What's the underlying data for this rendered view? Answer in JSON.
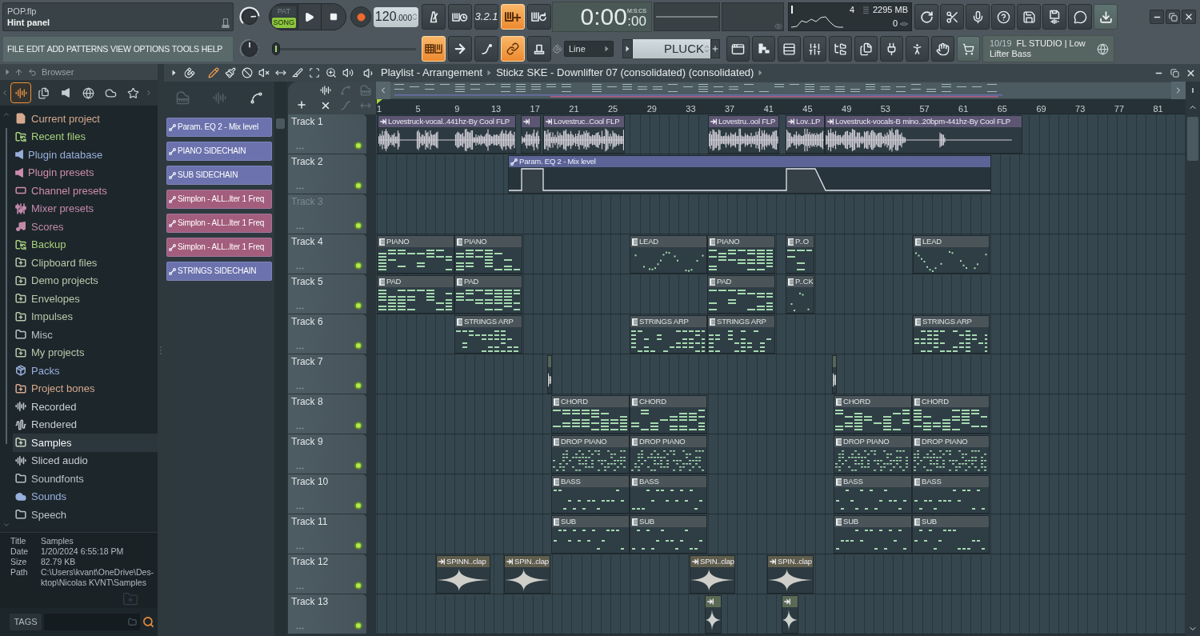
{
  "hint_panel": {
    "file": "POP.flp",
    "hint": "Hint panel"
  },
  "menu": [
    "FILE",
    "EDIT",
    "ADD",
    "PATTERNS",
    "VIEW",
    "OPTIONS",
    "TOOLS",
    "HELP"
  ],
  "knobs": [
    {
      "level": 0.82
    },
    {
      "level": 0.5
    }
  ],
  "transport": {
    "modes": [
      {
        "label": "PAT",
        "selected": false
      },
      {
        "label": "SONG",
        "selected": true
      }
    ],
    "tempo": "120",
    "tempo_fraction": ".000"
  },
  "record_options": [
    {
      "kind": "metronome",
      "on": false
    },
    {
      "kind": "wait",
      "on": false
    },
    {
      "kind": "countdown",
      "label": "3.2.1",
      "on": false
    },
    {
      "kind": "step-edit",
      "on": true
    },
    {
      "kind": "loop-record",
      "on": false
    }
  ],
  "time": {
    "value": "0:00",
    "fraction": ":00",
    "format": "M:S:CS"
  },
  "cpu": {
    "reading_1": "4",
    "memory": "2295 MB",
    "reading_2": "0"
  },
  "position_slider": {
    "level": 0
  },
  "edit_options": [
    {
      "kind": "step-grid",
      "on": true
    },
    {
      "kind": "arrow",
      "on": false
    },
    {
      "kind": "curve",
      "on": false
    },
    {
      "kind": "link",
      "on": true
    },
    {
      "kind": "knob",
      "on": false
    }
  ],
  "snap": "Line",
  "pattern": "PLUCK",
  "news": {
    "count": "10/19",
    "text": "FL STUDIO | Low Lifter Bass"
  },
  "browser": {
    "title": "Browser",
    "tabs": [
      {
        "kind": "all",
        "selected": true
      },
      {
        "kind": "files",
        "selected": false
      },
      {
        "kind": "plugins",
        "selected": false
      },
      {
        "kind": "web",
        "selected": false
      },
      {
        "kind": "cloud",
        "selected": false
      },
      {
        "kind": "favorites",
        "selected": false
      }
    ],
    "items": [
      {
        "label": "Current project",
        "kind": "project",
        "color": "#d6a98e",
        "selected": false
      },
      {
        "label": "Recent files",
        "kind": "recent",
        "color": "#a6cf7c",
        "selected": false
      },
      {
        "label": "Plugin database",
        "kind": "plugin",
        "color": "#98afdb",
        "selected": false
      },
      {
        "label": "Plugin presets",
        "kind": "plugin",
        "color": "#cf8cae",
        "selected": false
      },
      {
        "label": "Channel presets",
        "kind": "channel",
        "color": "#cf8cae",
        "selected": false
      },
      {
        "label": "Mixer presets",
        "kind": "mixer",
        "color": "#c48aac",
        "selected": false
      },
      {
        "label": "Scores",
        "kind": "score",
        "color": "#c08aa8",
        "selected": false
      },
      {
        "label": "Backup",
        "kind": "recent",
        "color": "#a6cf7c",
        "selected": false
      },
      {
        "label": "Clipboard files",
        "kind": "folder-plus",
        "color": "#b7c8aa",
        "selected": false
      },
      {
        "label": "Demo projects",
        "kind": "folder-plus",
        "color": "#b7c8aa",
        "selected": false
      },
      {
        "label": "Envelopes",
        "kind": "folder-plus",
        "color": "#b7c8aa",
        "selected": false
      },
      {
        "label": "Impulses",
        "kind": "folder-plus",
        "color": "#b7c8aa",
        "selected": false
      },
      {
        "label": "Misc",
        "kind": "folder",
        "color": "#b5c2c7",
        "selected": false
      },
      {
        "label": "My projects",
        "kind": "folder-plus",
        "color": "#b7c8aa",
        "selected": false
      },
      {
        "label": "Packs",
        "kind": "packs",
        "color": "#98afdb",
        "selected": false
      },
      {
        "label": "Project bones",
        "kind": "folder-plus",
        "color": "#d6a98e",
        "selected": false
      },
      {
        "label": "Recorded",
        "kind": "wave",
        "color": "#c6ced2",
        "selected": false
      },
      {
        "label": "Rendered",
        "kind": "rendered",
        "color": "#c6ced2",
        "selected": false
      },
      {
        "label": "Samples",
        "kind": "folder-plus",
        "color": "#c9d6bf",
        "selected": true
      },
      {
        "label": "Sliced audio",
        "kind": "wave",
        "color": "#c6ced2",
        "selected": false
      },
      {
        "label": "Soundfonts",
        "kind": "folder",
        "color": "#b5c2c7",
        "selected": false
      },
      {
        "label": "Sounds",
        "kind": "cloud",
        "color": "#98afdb",
        "selected": false
      },
      {
        "label": "Speech",
        "kind": "folder",
        "color": "#b5c2c7",
        "selected": false
      }
    ],
    "info": [
      {
        "label": "Title",
        "value": "Samples"
      },
      {
        "label": "Date",
        "value": "1/20/2024 6:55:18 PM"
      },
      {
        "label": "Size",
        "value": "82.79 KB"
      },
      {
        "label": "Path",
        "value": "C:\\Users\\kvant\\OneDrive\\Des-ktop\\Nicolas KVNT\\Samples"
      }
    ],
    "tags": "TAGS"
  },
  "playlist": {
    "title": "Playlist - Arrangement",
    "selection": "Stickz SKE - Downlifter 07 (consolidated) (consolidated)",
    "tools": [
      {
        "kind": "draw",
        "selected": true
      },
      {
        "kind": "paint",
        "selected": false
      },
      {
        "kind": "delete",
        "selected": false
      },
      {
        "kind": "mute",
        "selected": false
      },
      {
        "kind": "slip",
        "selected": false
      },
      {
        "kind": "slice",
        "selected": false
      },
      {
        "kind": "select",
        "selected": false
      },
      {
        "kind": "zoom",
        "selected": false
      },
      {
        "kind": "playback",
        "selected": false
      }
    ],
    "picker_tabs": [
      {
        "kind": "pattern",
        "selected": false
      },
      {
        "kind": "audio",
        "selected": false
      },
      {
        "kind": "automation",
        "selected": true
      }
    ],
    "picker_items": [
      {
        "label": "Param. EQ 2 - Mix level",
        "color": "#6b72ad"
      },
      {
        "label": "PIANO SIDECHAIN",
        "color": "#6b72ad"
      },
      {
        "label": "SUB SIDECHAIN",
        "color": "#6b72ad"
      },
      {
        "label": "Simplon - ALL..lter 1 Freq",
        "color": "#a35d7d"
      },
      {
        "label": "Simplon - ALL..lter 1 Freq",
        "color": "#a35d7d"
      },
      {
        "label": "Simplon - ALL..lter 1 Freq",
        "color": "#a35d7d"
      },
      {
        "label": "STRINGS SIDECHAIN",
        "color": "#6b72ad"
      }
    ],
    "track_filters": [
      {
        "kind": "audio",
        "on": true
      },
      {
        "kind": "automation",
        "on": false
      },
      {
        "kind": "pattern",
        "on": false
      },
      {
        "kind": "clear",
        "on": true
      },
      {
        "kind": "curve",
        "on": false
      },
      {
        "kind": "stretch",
        "on": false
      }
    ],
    "ruler": [
      "1",
      "5",
      "9",
      "13",
      "17",
      "21",
      "25",
      "29",
      "33",
      "37",
      "41",
      "45",
      "49",
      "53",
      "57",
      "61",
      "65",
      "69",
      "73",
      "77",
      "81"
    ],
    "tracks": [
      {
        "name": "Track 1",
        "dimmed": false,
        "enabled": true,
        "clips": [
          {
            "kind": "audio",
            "label": "Lovestruck-vocal..441hz-By Cool FLP",
            "color": "#5c5673"
          },
          {
            "kind": "audio",
            "color": "#5c5673"
          },
          {
            "kind": "audio",
            "label": "Lovestruc..Cool FLP",
            "color": "#5c5673"
          },
          {
            "kind": "audio",
            "label": "Lovestru..ool FLP",
            "color": "#5c5673"
          },
          {
            "kind": "audio",
            "label": "Lov..LP",
            "color": "#5c5673"
          },
          {
            "kind": "audio",
            "label": "Lovestruck-vocals-B mino..20bpm-441hz-By Cool FLP",
            "color": "#5c5673"
          }
        ]
      },
      {
        "name": "Track 2",
        "dimmed": false,
        "enabled": true,
        "clips": [
          {
            "kind": "automation",
            "label": "Param. EQ 2 - Mix level",
            "color": "#5c6497"
          }
        ]
      },
      {
        "name": "Track 3",
        "dimmed": true,
        "enabled": true
      },
      {
        "name": "Track 4",
        "dimmed": false,
        "enabled": true,
        "clips": [
          {
            "kind": "pattern",
            "label": "PIANO",
            "color": "#4b5458"
          },
          {
            "kind": "pattern",
            "label": "PIANO",
            "color": "#4b5458"
          },
          {
            "kind": "pattern",
            "label": "LEAD",
            "color": "#4b5458"
          },
          {
            "kind": "pattern",
            "label": "PIANO",
            "color": "#4b5458"
          },
          {
            "kind": "pattern",
            "label": "P..O",
            "color": "#4b5458"
          },
          {
            "kind": "pattern",
            "label": "LEAD",
            "color": "#4b5458"
          }
        ]
      },
      {
        "name": "Track 5",
        "dimmed": false,
        "enabled": true,
        "clips": [
          {
            "kind": "pattern",
            "label": "PAD",
            "color": "#4b5458"
          },
          {
            "kind": "pattern",
            "label": "PAD",
            "color": "#4b5458"
          },
          {
            "kind": "pattern",
            "label": "PAD",
            "color": "#4b5458"
          },
          {
            "kind": "pattern",
            "label": "P..CK",
            "color": "#4b5458"
          }
        ]
      },
      {
        "name": "Track 6",
        "dimmed": false,
        "enabled": true,
        "clips": [
          {
            "kind": "pattern",
            "label": "STRINGS ARP",
            "color": "#4b5458"
          },
          {
            "kind": "pattern",
            "label": "STRINGS ARP",
            "color": "#4b5458"
          },
          {
            "kind": "pattern",
            "label": "STRINGS ARP",
            "color": "#4b5458"
          },
          {
            "kind": "pattern",
            "label": "STRINGS ARP",
            "color": "#4b5458"
          }
        ]
      },
      {
        "name": "Track 7",
        "dimmed": false,
        "enabled": true,
        "clips": [
          {
            "kind": "audio",
            "color": "#56645a"
          },
          {
            "kind": "audio",
            "color": "#56645a"
          }
        ]
      },
      {
        "name": "Track 8",
        "dimmed": false,
        "enabled": true,
        "clips": [
          {
            "kind": "pattern",
            "label": "CHORD",
            "color": "#4b5458"
          },
          {
            "kind": "pattern",
            "label": "CHORD",
            "color": "#4b5458"
          },
          {
            "kind": "pattern",
            "label": "CHORD",
            "color": "#4b5458"
          },
          {
            "kind": "pattern",
            "label": "CHORD",
            "color": "#4b5458"
          }
        ]
      },
      {
        "name": "Track 9",
        "dimmed": false,
        "enabled": true,
        "clips": [
          {
            "kind": "pattern",
            "label": "DROP PIANO",
            "color": "#4b5458"
          },
          {
            "kind": "pattern",
            "label": "DROP PIANO",
            "color": "#4b5458"
          },
          {
            "kind": "pattern",
            "label": "DROP PIANO",
            "color": "#4b5458"
          },
          {
            "kind": "pattern",
            "label": "DROP PIANO",
            "color": "#4b5458"
          }
        ]
      },
      {
        "name": "Track 10",
        "dimmed": false,
        "enabled": true,
        "clips": [
          {
            "kind": "pattern",
            "label": "BASS",
            "color": "#4b5458"
          },
          {
            "kind": "pattern",
            "label": "BASS",
            "color": "#4b5458"
          },
          {
            "kind": "pattern",
            "label": "BASS",
            "color": "#4b5458"
          },
          {
            "kind": "pattern",
            "label": "BASS",
            "color": "#4b5458"
          }
        ]
      },
      {
        "name": "Track 11",
        "dimmed": false,
        "enabled": true,
        "clips": [
          {
            "kind": "pattern",
            "label": "SUB",
            "color": "#4b5458"
          },
          {
            "kind": "pattern",
            "label": "SUB",
            "color": "#4b5458"
          },
          {
            "kind": "pattern",
            "label": "SUB",
            "color": "#4b5458"
          },
          {
            "kind": "pattern",
            "label": "SUB",
            "color": "#4b5458"
          }
        ]
      },
      {
        "name": "Track 12",
        "dimmed": false,
        "enabled": true,
        "clips": [
          {
            "kind": "audio",
            "label": "SPINN..clap",
            "color": "#5f5d4b"
          },
          {
            "kind": "audio",
            "label": "SPIN..clap",
            "color": "#5f5d4b"
          },
          {
            "kind": "audio",
            "label": "SPIN..clap",
            "color": "#5f5d4b"
          },
          {
            "kind": "audio",
            "label": "SPIN..clap",
            "color": "#5f5d4b"
          }
        ]
      },
      {
        "name": "Track 13",
        "dimmed": false,
        "enabled": true,
        "clips": [
          {
            "kind": "audio",
            "color": "#5a6a55"
          },
          {
            "kind": "audio",
            "color": "#5a6a55"
          }
        ]
      }
    ]
  }
}
